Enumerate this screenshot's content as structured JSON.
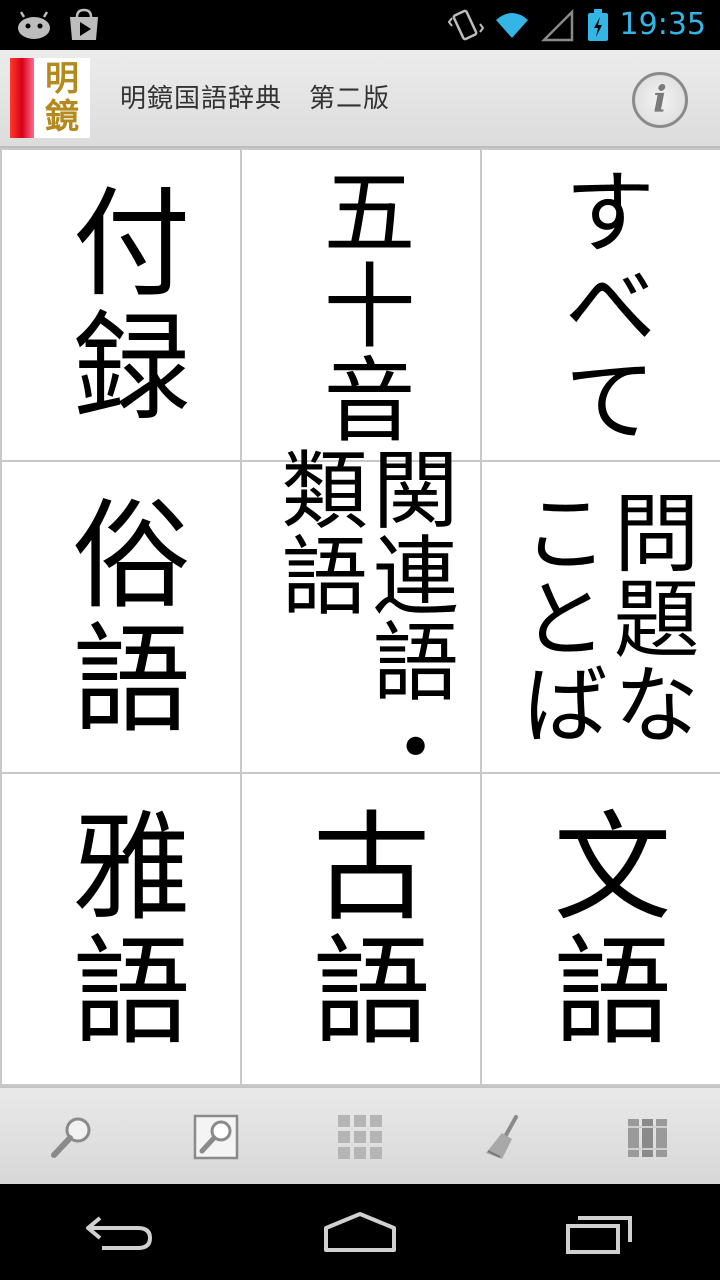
{
  "status_bar": {
    "time": "19:35",
    "icons": [
      "android-debug-icon",
      "play-store-icon",
      "vibrate-icon",
      "wifi-icon",
      "signal-icon",
      "battery-charging-icon"
    ],
    "accent_color": "#33b5e5"
  },
  "header": {
    "logo_text": [
      "明",
      "鏡"
    ],
    "title": "明鏡国語辞典　第二版",
    "info_label": "i"
  },
  "grid": {
    "cells": [
      {
        "label": "付録",
        "size": "big"
      },
      {
        "label": "五十音",
        "size": "mid"
      },
      {
        "label": "すべて",
        "size": "mid"
      },
      {
        "label": "俗語",
        "size": "big"
      },
      {
        "label": "関連語・\n類語",
        "size": "small"
      },
      {
        "label": "問題な\nことば",
        "size": "small"
      },
      {
        "label": "雅語",
        "size": "big"
      },
      {
        "label": "古語",
        "size": "big"
      },
      {
        "label": "文語",
        "size": "big"
      }
    ]
  },
  "toolbar": {
    "buttons": [
      "search-icon",
      "search-page-icon",
      "grid-menu-icon",
      "brush-icon",
      "bookshelf-icon"
    ]
  },
  "nav_bar": {
    "buttons": [
      "back-icon",
      "home-icon",
      "recent-apps-icon"
    ]
  }
}
